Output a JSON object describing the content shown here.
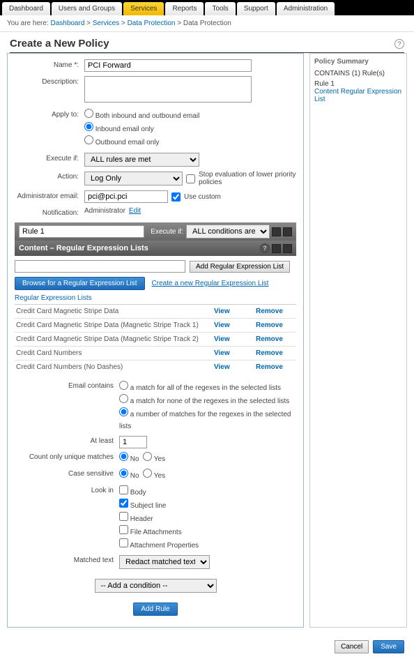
{
  "tabs": [
    "Dashboard",
    "Users and Groups",
    "Services",
    "Reports",
    "Tools",
    "Support",
    "Administration"
  ],
  "activeTab": 2,
  "breadcrumb": {
    "prefix": "You are here:",
    "items": [
      "Dashboard",
      "Services",
      "Data Protection"
    ],
    "current": "Data Protection"
  },
  "pageTitle": "Create a New Policy",
  "form": {
    "nameLabel": "Name *:",
    "nameValue": "PCI Forward",
    "descLabel": "Description:",
    "descValue": "",
    "applyLabel": "Apply to:",
    "applyOpts": [
      "Both inbound and outbound email",
      "Inbound email only",
      "Outbound email only"
    ],
    "execLabel": "Execute if:",
    "execValue": "ALL rules are met",
    "actionLabel": "Action:",
    "actionValue": "Log Only",
    "stopEvalLabel": "Stop evaluation of lower priority policies",
    "adminLabel": "Administrator email:",
    "adminValue": "pci@pci.pci",
    "useCustom": "Use custom",
    "notifLabel": "Notification:",
    "notifText": "Administrator",
    "editLink": "Edit"
  },
  "rule": {
    "name": "Rule 1",
    "execLabel": "Execute if:",
    "execValue": "ALL conditions are met",
    "sectionTitle": "Content – Regular Expression Lists",
    "addRegexBtn": "Add Regular Expression List",
    "browseBtn": "Browse for a Regular Expression List",
    "createLink": "Create a new Regular Expression List",
    "tableTitle": "Regular Expression Lists",
    "items": [
      {
        "n": "Credit Card Magnetic Stripe Data"
      },
      {
        "n": "Credit Card Magnetic Stripe Data (Magnetic Stripe Track 1)"
      },
      {
        "n": "Credit Card Magnetic Stripe Data (Magnetic Stripe Track 2)"
      },
      {
        "n": "Credit Card Numbers"
      },
      {
        "n": "Credit Card Numbers (No Dashes)"
      }
    ],
    "viewLbl": "View",
    "removeLbl": "Remove",
    "emailContainsLabel": "Email contains",
    "emailContainsOpts": [
      "a match for all of the regexes in the selected lists",
      "a match for none of the regexes in the selected lists",
      "a number of matches for the regexes in the selected lists"
    ],
    "atLeastLabel": "At least",
    "atLeastValue": "1",
    "uniqueLabel": "Count only unique matches",
    "no": "No",
    "yes": "Yes",
    "caseLabel": "Case sensitive",
    "lookInLabel": "Look in",
    "lookInOpts": [
      "Body",
      "Subject line",
      "Header",
      "File Attachments",
      "Attachment Properties"
    ],
    "matchedLabel": "Matched text",
    "matchedValue": "Redact matched text",
    "addCondition": "-- Add a condition --",
    "addRuleBtn": "Add Rule"
  },
  "summary": {
    "title": "Policy Summary",
    "contains": "CONTAINS (1) Rule(s)",
    "rule": "Rule 1",
    "link": "Content Regular Expression List"
  },
  "footer": {
    "cancel": "Cancel",
    "save": "Save"
  }
}
